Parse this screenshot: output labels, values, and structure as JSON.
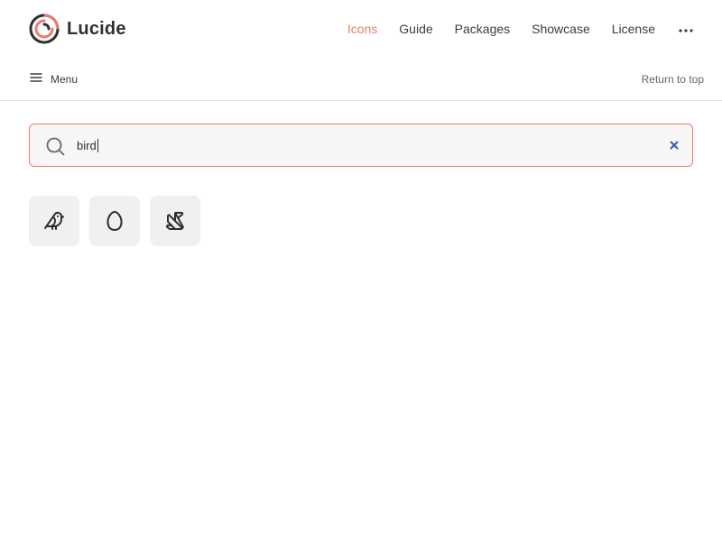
{
  "brand": {
    "name": "Lucide",
    "logo_icon": "lucide-logo-icon"
  },
  "nav": {
    "items": [
      {
        "label": "Icons",
        "active": true
      },
      {
        "label": "Guide",
        "active": false
      },
      {
        "label": "Packages",
        "active": false
      },
      {
        "label": "Showcase",
        "active": false
      },
      {
        "label": "License",
        "active": false
      }
    ],
    "more_icon": "ellipsis-icon"
  },
  "localnav": {
    "menu_label": "Menu",
    "menu_icon": "menu-icon",
    "return_top_label": "Return to top"
  },
  "search": {
    "value": "bird",
    "search_icon": "search-icon",
    "clear_icon": "close-icon"
  },
  "results": [
    {
      "icon": "bird-icon"
    },
    {
      "icon": "egg-icon"
    },
    {
      "icon": "origami-icon"
    }
  ],
  "colors": {
    "accent": "#f07a6b",
    "accent_dark": "#2e2e33",
    "clear": "#2f5ea8",
    "tile_bg": "#f0f0f1",
    "search_bg": "#f6f6f7"
  }
}
